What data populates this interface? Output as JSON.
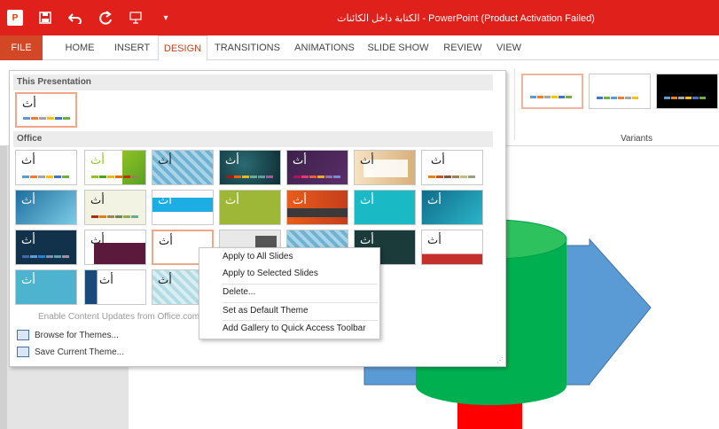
{
  "titlebar": {
    "title": "الكتابة داخل الكائنات - PowerPoint (Product Activation Failed)",
    "qat": {
      "app_icon": "powerpoint-icon",
      "save_icon": "save-icon",
      "undo_icon": "undo-icon",
      "redo_icon": "redo-icon",
      "present_icon": "present-from-start-icon",
      "customize_icon": "customize-qat-icon"
    }
  },
  "tabs": [
    {
      "label": "FILE"
    },
    {
      "label": "HOME"
    },
    {
      "label": "INSERT"
    },
    {
      "label": "DESIGN"
    },
    {
      "label": "TRANSITIONS"
    },
    {
      "label": "ANIMATIONS"
    },
    {
      "label": "SLIDE SHOW"
    },
    {
      "label": "REVIEW"
    },
    {
      "label": "VIEW"
    }
  ],
  "active_tab": "DESIGN",
  "ribbon": {
    "variants_label": "Variants"
  },
  "gallery": {
    "sections": {
      "this_presentation": "This Presentation",
      "office": "Office"
    },
    "theme_glyph": "أث",
    "links": {
      "enable_updates": "Enable Content Updates from Office.com...",
      "browse": "Browse for Themes...",
      "save_current": "Save Current Theme..."
    }
  },
  "context_menu": {
    "apply_all": "Apply to All Slides",
    "apply_selected": "Apply to Selected Slides",
    "delete": "Delete...",
    "set_default": "Set as Default Theme",
    "add_gallery": "Add Gallery to Quick Access Toolbar"
  },
  "colors": {
    "title_bar": "#e0201b",
    "accent": "#c43e1c",
    "slide_green": "#00b050",
    "slide_red": "#ff0000",
    "slide_blue": "#5b9bd5"
  }
}
